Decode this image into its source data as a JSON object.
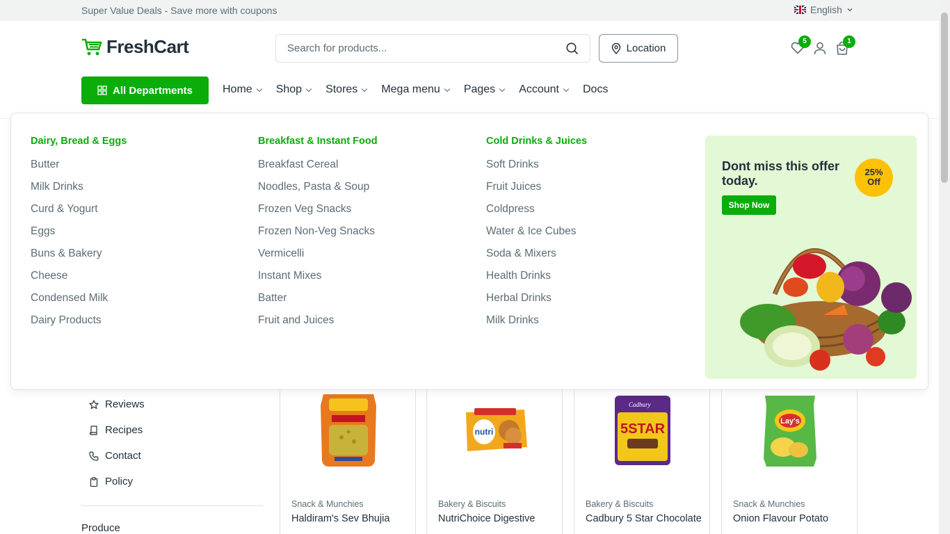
{
  "topbar": {
    "promo": "Super Value Deals - Save more with coupons",
    "language": "English"
  },
  "header": {
    "logo_text": "FreshCart",
    "search_placeholder": "Search for products...",
    "location_label": "Location",
    "wishlist_count": "5",
    "cart_count": "1"
  },
  "nav": {
    "all_departments": "All Departments",
    "items": [
      {
        "label": "Home"
      },
      {
        "label": "Shop"
      },
      {
        "label": "Stores"
      },
      {
        "label": "Mega menu"
      },
      {
        "label": "Pages"
      },
      {
        "label": "Account"
      },
      {
        "label": "Docs"
      }
    ]
  },
  "mega": {
    "columns": [
      {
        "heading": "Dairy, Bread & Eggs",
        "links": [
          "Butter",
          "Milk Drinks",
          "Curd & Yogurt",
          "Eggs",
          "Buns & Bakery",
          "Cheese",
          "Condensed Milk",
          "Dairy Products"
        ]
      },
      {
        "heading": "Breakfast & Instant Food",
        "links": [
          "Breakfast Cereal",
          "Noodles, Pasta & Soup",
          "Frozen Veg Snacks",
          "Frozen Non-Veg Snacks",
          "Vermicelli",
          "Instant Mixes",
          "Batter",
          "Fruit and Juices"
        ]
      },
      {
        "heading": "Cold Drinks & Juices",
        "links": [
          "Soft Drinks",
          "Fruit Juices",
          "Coldpress",
          "Water & Ice Cubes",
          "Soda & Mixers",
          "Health Drinks",
          "Herbal Drinks",
          "Milk Drinks"
        ]
      }
    ],
    "promo": {
      "title": "Dont miss this offer today.",
      "button": "Shop Now",
      "badge_line1": "25%",
      "badge_line2": "Off"
    }
  },
  "sidebar": {
    "items": [
      {
        "label": "Reviews",
        "icon": "star-icon"
      },
      {
        "label": "Recipes",
        "icon": "book-icon"
      },
      {
        "label": "Contact",
        "icon": "phone-icon"
      },
      {
        "label": "Policy",
        "icon": "clipboard-icon"
      }
    ],
    "section": "Produce"
  },
  "products": [
    {
      "category": "Snack & Munchies",
      "name": "Haldiram's Sev Bhujia"
    },
    {
      "category": "Bakery & Biscuits",
      "name": "NutriChoice Digestive"
    },
    {
      "category": "Bakery & Biscuits",
      "name": "Cadbury 5 Star Chocolate"
    },
    {
      "category": "Snack & Munchies",
      "name": "Onion Flavour Potato"
    }
  ],
  "colors": {
    "brand_green": "#0aad0a",
    "badge_yellow": "#ffc107",
    "promo_bg": "#e3f8d4"
  }
}
